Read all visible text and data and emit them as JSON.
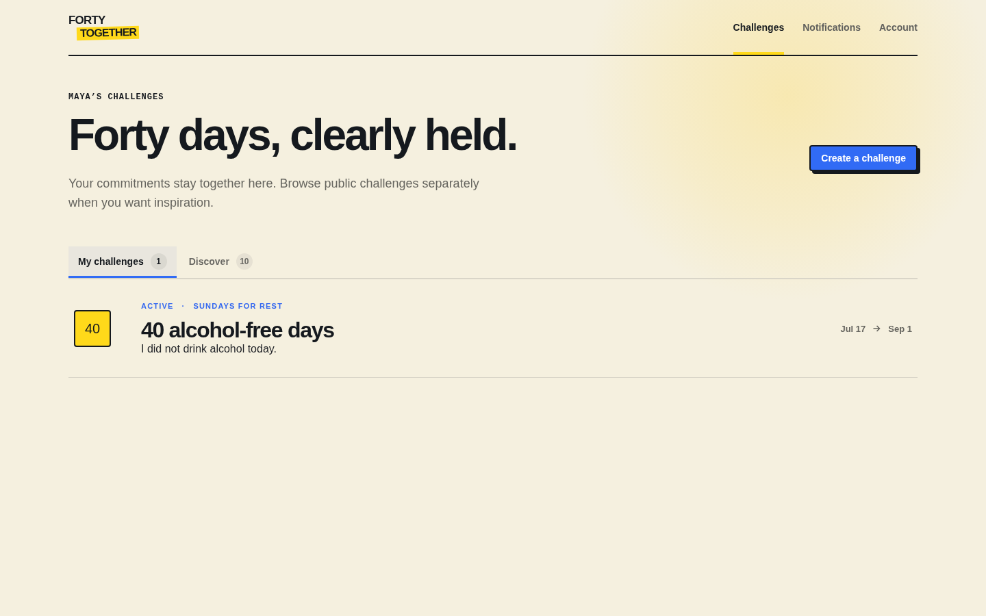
{
  "brand": {
    "line_1": "FORTY",
    "line_2": "TOGETHER"
  },
  "nav": [
    {
      "label": "Challenges",
      "selected": true
    },
    {
      "label": "Notifications",
      "selected": false
    },
    {
      "label": "Account",
      "selected": false
    }
  ],
  "hero": {
    "eyebrow": "MAYA’S CHALLENGES",
    "title": "Forty days, clearly held.",
    "subtitle": "Your commitments stay together here. Browse public challenges separately when you want inspiration.",
    "action": "Create a challenge"
  },
  "tabs": [
    {
      "label": "My challenges",
      "count": "1",
      "selected": true
    },
    {
      "label": "Discover",
      "count": "10",
      "selected": false
    }
  ],
  "challenges": [
    {
      "days": "40",
      "status": "ACTIVE",
      "separator": "·",
      "rule": "SUNDAYS FOR REST",
      "title": "40 alcohol-free days",
      "description": "I did not drink alcohol today.",
      "start": "Jul 17",
      "end": "Sep 1"
    }
  ]
}
